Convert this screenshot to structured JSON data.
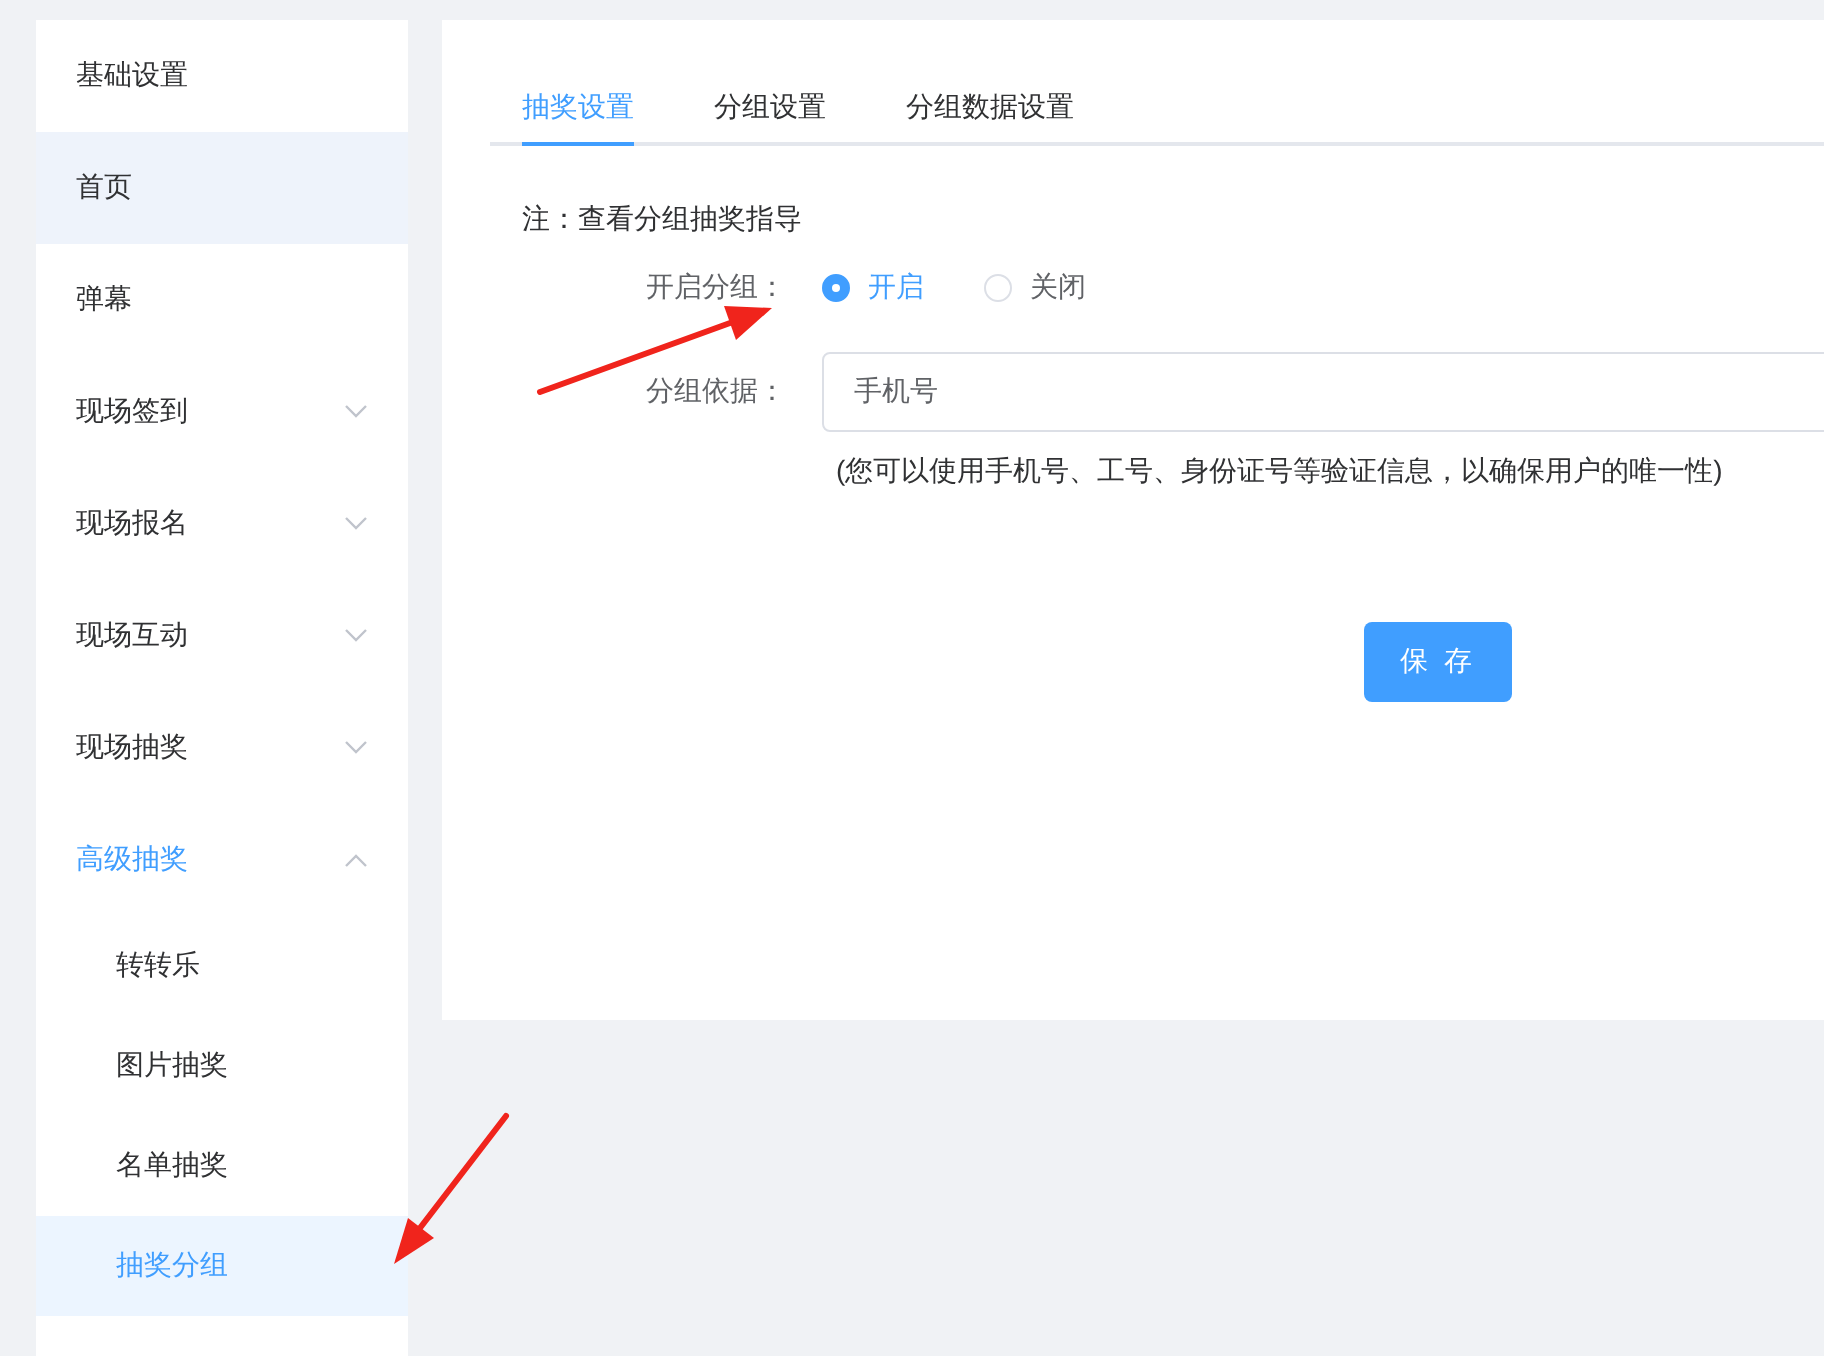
{
  "sidebar": {
    "items": [
      {
        "label": "基础设置",
        "kind": "item",
        "selected": false,
        "hovered": false
      },
      {
        "label": "首页",
        "kind": "item",
        "selected": false,
        "hovered": true
      },
      {
        "label": "弹幕",
        "kind": "item",
        "selected": false,
        "hovered": false
      },
      {
        "label": "现场签到",
        "kind": "group",
        "selected": false,
        "hovered": false,
        "expanded": false
      },
      {
        "label": "现场报名",
        "kind": "group",
        "selected": false,
        "hovered": false,
        "expanded": false
      },
      {
        "label": "现场互动",
        "kind": "group",
        "selected": false,
        "hovered": false,
        "expanded": false
      },
      {
        "label": "现场抽奖",
        "kind": "group",
        "selected": false,
        "hovered": false,
        "expanded": false
      },
      {
        "label": "高级抽奖",
        "kind": "group",
        "selected": true,
        "hovered": false,
        "expanded": true,
        "children": [
          {
            "label": "转转乐",
            "kind": "item",
            "selected": false,
            "hovered": false
          },
          {
            "label": "图片抽奖",
            "kind": "item",
            "selected": false,
            "hovered": false
          },
          {
            "label": "名单抽奖",
            "kind": "item",
            "selected": false,
            "hovered": false
          },
          {
            "label": "抽奖分组",
            "kind": "item",
            "selected": true,
            "hovered": false
          }
        ]
      }
    ]
  },
  "tabs": [
    {
      "label": "抽奖设置",
      "selected": true
    },
    {
      "label": "分组设置",
      "selected": false
    },
    {
      "label": "分组数据设置",
      "selected": false
    }
  ],
  "note": "注：查看分组抽奖指导",
  "form": {
    "fields": [
      {
        "kind": "radio",
        "label": "开启分组：",
        "options": [
          {
            "label": "开启",
            "selected": true
          },
          {
            "label": "关闭",
            "selected": false
          }
        ]
      },
      {
        "kind": "input",
        "label": "分组依据：",
        "value": "手机号",
        "hint": "(您可以使用手机号、工号、身份证号等验证信息，以确保用户的唯一性)"
      }
    ]
  },
  "save_button": "保 存",
  "annotations": [
    {
      "kind": "arrow"
    },
    {
      "kind": "arrow"
    }
  ]
}
